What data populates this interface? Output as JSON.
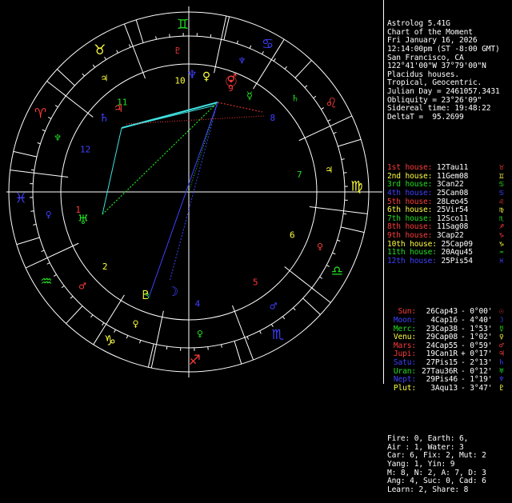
{
  "app": {
    "name": "Astrolog 5.41G"
  },
  "chart_info": {
    "lines": [
      "Astrolog 5.41G",
      "Chart of the Moment",
      "Fri January 16, 2026",
      "12:14:00pm (ST -8:00 GMT)",
      "San Francisco, CA",
      "122°41'00\"W 37°79'00\"N",
      "Placidus houses.",
      "Tropical, Geocentric.",
      "Julian Day = 2461057.3431",
      "Obliquity = 23°26'09\"",
      "Sidereal time: 19:48:22",
      "DeltaT =  95.2699"
    ]
  },
  "houses": [
    {
      "label": "1st house:",
      "value": "12Tau11",
      "glyph": "♉",
      "color": "#ff3b3b"
    },
    {
      "label": "2nd house:",
      "value": "11Gem08",
      "glyph": "♊",
      "color": "#ffff40"
    },
    {
      "label": "3rd house:",
      "value": "3Can22",
      "glyph": "♋",
      "color": "#20e020"
    },
    {
      "label": "4th house:",
      "value": "25Can08",
      "glyph": "♋",
      "color": "#4040ff"
    },
    {
      "label": "5th house:",
      "value": "28Leo45",
      "glyph": "♌",
      "color": "#ff3b3b"
    },
    {
      "label": "6th house:",
      "value": "25Vir54",
      "glyph": "♍",
      "color": "#ffff40"
    },
    {
      "label": "7th house:",
      "value": "12Sco11",
      "glyph": "♏",
      "color": "#20e020"
    },
    {
      "label": "8th house:",
      "value": "11Sag08",
      "glyph": "♐",
      "color": "#ff3b3b"
    },
    {
      "label": "9th house:",
      "value": "3Cap22",
      "glyph": "♑",
      "color": "#ff3b3b"
    },
    {
      "label": "10th house:",
      "value": "25Cap09",
      "glyph": "♑",
      "color": "#ffff40"
    },
    {
      "label": "11th house:",
      "value": "20Aqu45",
      "glyph": "♒",
      "color": "#20e020"
    },
    {
      "label": "12th house:",
      "value": "25Pis54",
      "glyph": "♓",
      "color": "#4040ff"
    }
  ],
  "planets": [
    {
      "name": "Sun:",
      "pos": "26Cap43",
      "retro": " ",
      "lat": "- 0°00'",
      "glyph": "☉",
      "color": "#ff3b3b"
    },
    {
      "name": "Moon:",
      "pos": "4Cap16",
      "retro": " ",
      "lat": "- 4°40'",
      "glyph": "☽",
      "color": "#4040ff"
    },
    {
      "name": "Merc:",
      "pos": "23Cap38",
      "retro": " ",
      "lat": "- 1°53'",
      "glyph": "☿",
      "color": "#20e020"
    },
    {
      "name": "Venu:",
      "pos": "29Cap08",
      "retro": " ",
      "lat": "- 1°02'",
      "glyph": "♀",
      "color": "#ffff40"
    },
    {
      "name": "Mars:",
      "pos": "24Cap55",
      "retro": " ",
      "lat": "- 0°59'",
      "glyph": "♂",
      "color": "#ff3b3b"
    },
    {
      "name": "Jupi:",
      "pos": "19Can1R",
      "retro": "R",
      "lat": "+ 0°17'",
      "glyph": "♃",
      "color": "#ff3b3b"
    },
    {
      "name": "Satu:",
      "pos": "27Pis15",
      "retro": " ",
      "lat": "- 2°13'",
      "glyph": "♄",
      "color": "#4040ff"
    },
    {
      "name": "Uran:",
      "pos": "27Tau36R",
      "retro": "R",
      "lat": "- 0°12'",
      "glyph": "♅",
      "color": "#20e020"
    },
    {
      "name": "Nept:",
      "pos": "29Pis46",
      "retro": " ",
      "lat": "- 1°19'",
      "glyph": "♆",
      "color": "#4040ff"
    },
    {
      "name": "Plut:",
      "pos": "3Aqu13",
      "retro": " ",
      "lat": "- 3°47'",
      "glyph": "♇",
      "color": "#ffff40"
    }
  ],
  "summary": [
    "Fire: 0, Earth: 6,",
    "Air : 1, Water: 3",
    "Car: 6, Fix: 2, Mut: 2",
    "Yang: 1, Yin: 9",
    "M: 8, N: 2, A: 7, D: 3",
    "Ang: 4, Suc: 0, Cad: 6",
    "Learn: 2, Share: 8"
  ],
  "wheel": {
    "house_numbers": [
      "1",
      "2",
      "3",
      "4",
      "5",
      "6",
      "7",
      "8",
      "9",
      "10",
      "11",
      "12"
    ],
    "sign_glyphs": [
      "♈",
      "♉",
      "♊",
      "♋",
      "♌",
      "♍",
      "♎",
      "♏",
      "♐",
      "♑",
      "♒",
      "♓"
    ],
    "sign_colors": [
      "#ff3b3b",
      "#ffff40",
      "#20e020",
      "#4040ff",
      "#ff3b3b",
      "#ffff40",
      "#20e020",
      "#4040ff",
      "#ff3b3b",
      "#ffff40",
      "#20e020",
      "#4040ff"
    ],
    "house_glyphs": [
      "♀",
      "♂",
      "♀",
      "♀",
      "♂",
      "♀",
      "♃",
      "♄",
      "♆",
      "♇",
      "♃",
      "♆"
    ]
  }
}
